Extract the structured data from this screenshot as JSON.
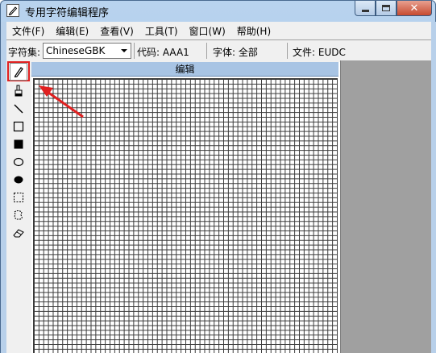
{
  "window": {
    "title": "专用字符编辑程序",
    "minimize_icon": "minimize-icon",
    "maximize_icon": "maximize-icon",
    "close_icon": "close-icon"
  },
  "menubar": {
    "items": [
      {
        "label": "文件(F)"
      },
      {
        "label": "编辑(E)"
      },
      {
        "label": "查看(V)"
      },
      {
        "label": "工具(T)"
      },
      {
        "label": "窗口(W)"
      },
      {
        "label": "帮助(H)"
      }
    ]
  },
  "infobar": {
    "charset_label": "字符集:",
    "charset_value": "ChineseGBK",
    "code_label": "代码: AAA1",
    "font_label": "字体: 全部",
    "file_label": "文件: EUDC"
  },
  "editor": {
    "header": "编辑"
  },
  "tools": [
    {
      "icon": "pencil-icon"
    },
    {
      "icon": "brush-icon"
    },
    {
      "icon": "line-icon"
    },
    {
      "icon": "hollow-rectangle-icon"
    },
    {
      "icon": "filled-rectangle-icon"
    },
    {
      "icon": "hollow-ellipse-icon"
    },
    {
      "icon": "filled-ellipse-icon"
    },
    {
      "icon": "rect-select-icon"
    },
    {
      "icon": "freeform-select-icon"
    },
    {
      "icon": "eraser-icon"
    }
  ],
  "colors": {
    "highlight": "#e02020",
    "header_bg": "#a8c4e4"
  }
}
